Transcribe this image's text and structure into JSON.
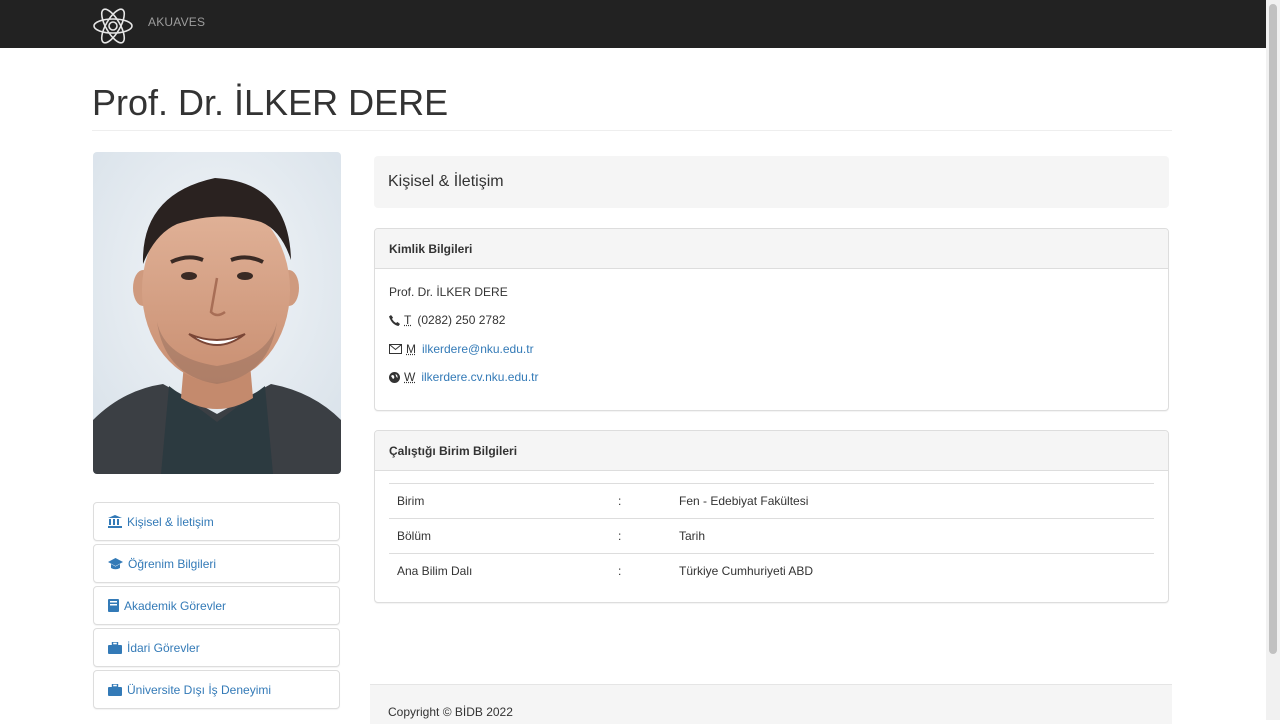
{
  "navbar": {
    "brand": "AKUAVES",
    "logo_icon": "atom-logo-icon"
  },
  "page": {
    "title": "Prof. Dr. İLKER DERE"
  },
  "side_menu": {
    "items": [
      {
        "label": "Kişisel & İletişim",
        "icon": "institution-icon"
      },
      {
        "label": "Öğrenim Bilgileri",
        "icon": "graduation-cap-icon"
      },
      {
        "label": "Akademik Görevler",
        "icon": "book-icon"
      },
      {
        "label": "İdari Görevler",
        "icon": "briefcase-icon"
      },
      {
        "label": "Üniversite Dışı İş Deneyimi",
        "icon": "briefcase-icon"
      }
    ]
  },
  "section": {
    "title": "Kişisel & İletişim"
  },
  "identity": {
    "heading": "Kimlik Bilgileri",
    "name": "Prof. Dr. İLKER DERE",
    "phone_abbr": "T",
    "phone": "(0282) 250 2782",
    "mail_abbr": "M",
    "email": "ilkerdere@nku.edu.tr",
    "web_abbr": "W",
    "website": "ilkerdere.cv.nku.edu.tr"
  },
  "unit": {
    "heading": "Çalıştığı Birim Bilgileri",
    "separator": ":",
    "rows": [
      {
        "label": "Birim",
        "value": "Fen - Edebiyat Fakültesi"
      },
      {
        "label": "Bölüm",
        "value": "Tarih"
      },
      {
        "label": "Ana Bilim Dalı",
        "value": "Türkiye Cumhuriyeti ABD"
      }
    ]
  },
  "footer": {
    "copyright": "Copyright © BİDB 2022"
  },
  "colors": {
    "navbar": "#222222",
    "link": "#337ab7",
    "panel_head": "#f5f5f5"
  }
}
